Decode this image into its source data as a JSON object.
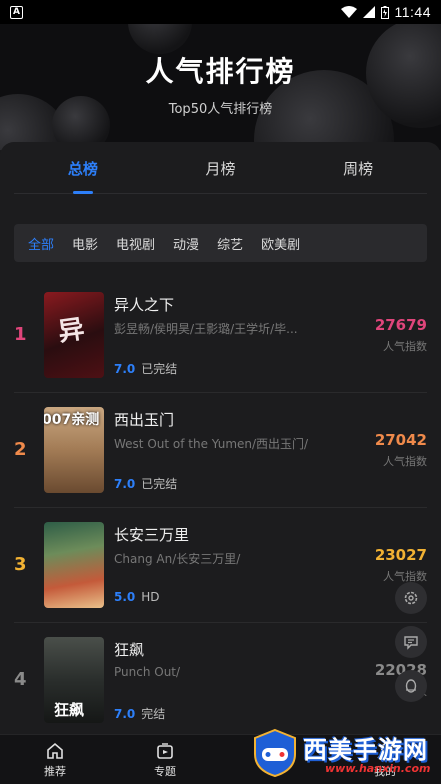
{
  "status_bar": {
    "time": "11:44"
  },
  "header": {
    "title": "人气排行榜",
    "subtitle": "Top50人气排行榜"
  },
  "tabs": [
    {
      "label": "总榜",
      "active": true
    },
    {
      "label": "月榜",
      "active": false
    },
    {
      "label": "周榜",
      "active": false
    }
  ],
  "filters": [
    {
      "label": "全部",
      "active": true
    },
    {
      "label": "电影"
    },
    {
      "label": "电视剧"
    },
    {
      "label": "动漫"
    },
    {
      "label": "综艺"
    },
    {
      "label": "欧美剧"
    }
  ],
  "items": [
    {
      "rank": "1",
      "title": "异人之下",
      "cast": "彭昱畅/侯明昊/王影璐/王学圻/毕...",
      "rating": "7.0",
      "status": "已完结",
      "score": "27679",
      "score_label": "人气指数",
      "rank_color": "#e0457b",
      "score_color": "#e0457b"
    },
    {
      "rank": "2",
      "title": "西出玉门",
      "cast": "West Out of the Yumen/西出玉门/",
      "rating": "7.0",
      "status": "已完结",
      "score": "27042",
      "score_label": "人气指数",
      "rank_color": "#f08a4b",
      "score_color": "#f08a4b",
      "poster_text": "007亲测"
    },
    {
      "rank": "3",
      "title": "长安三万里",
      "cast": "Chang An/长安三万里/",
      "rating": "5.0",
      "status": "HD",
      "score": "23027",
      "score_label": "人气指数",
      "rank_color": "#f2b233",
      "score_color": "#f2b233"
    },
    {
      "rank": "4",
      "title": "狂飙",
      "cast": "Punch Out/",
      "rating": "7.0",
      "status": "完结",
      "score": "22028",
      "score_label": "人",
      "rank_color": "#8a8a8a",
      "score_color": "#8a8a8a",
      "poster_text": "狂飙"
    }
  ],
  "bottom_nav": [
    {
      "label": "推荐",
      "icon": "home-icon"
    },
    {
      "label": "专题",
      "icon": "topic-icon"
    },
    {
      "label": "我的",
      "icon": "user-icon"
    }
  ],
  "watermark": {
    "text": "西美手游网",
    "url": "www.hanxin.com"
  }
}
